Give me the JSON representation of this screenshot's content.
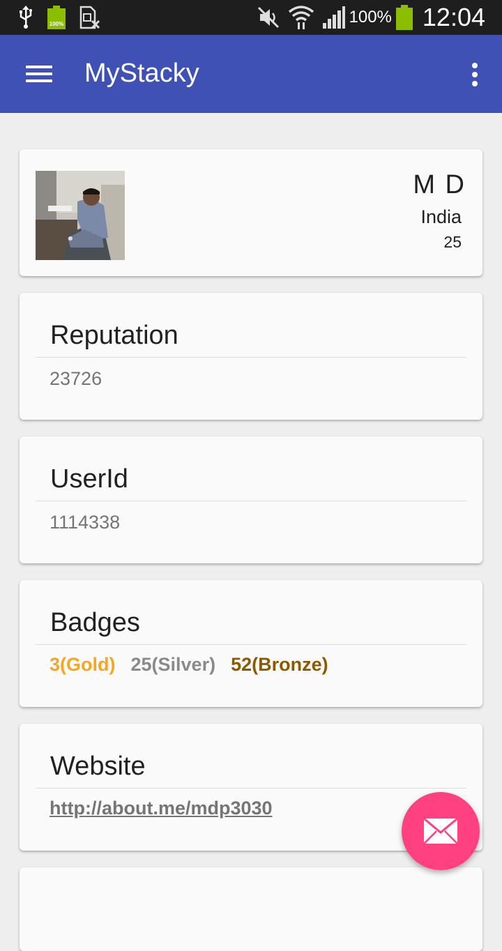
{
  "status_bar": {
    "battery_small_label": "100%",
    "battery_percent": "100%",
    "time": "12:04",
    "icons": [
      "usb-icon",
      "battery-icon",
      "sim-off-icon",
      "mute-icon",
      "wifi-icon",
      "signal-icon",
      "battery-icon"
    ],
    "battery_color": "#8bbd00"
  },
  "app_bar": {
    "title": "MyStacky",
    "color": "#3f51b5",
    "icons": [
      "menu-icon",
      "overflow-menu-icon"
    ]
  },
  "profile": {
    "name": "M D",
    "country": "India",
    "age": "25"
  },
  "reputation": {
    "title": "Reputation",
    "value": "23726"
  },
  "user_id": {
    "title": "UserId",
    "value": "1114338"
  },
  "badges": {
    "title": "Badges",
    "gold": "3(Gold)",
    "silver": "25(Silver)",
    "bronze": "52(Bronze)",
    "colors": {
      "gold": "#f5a623",
      "silver": "#8a8a8a",
      "bronze": "#8b5a00"
    }
  },
  "website": {
    "title": "Website",
    "url": "http://about.me/mdp3030"
  },
  "fab": {
    "icon": "mail-icon",
    "color": "#ff4081"
  }
}
